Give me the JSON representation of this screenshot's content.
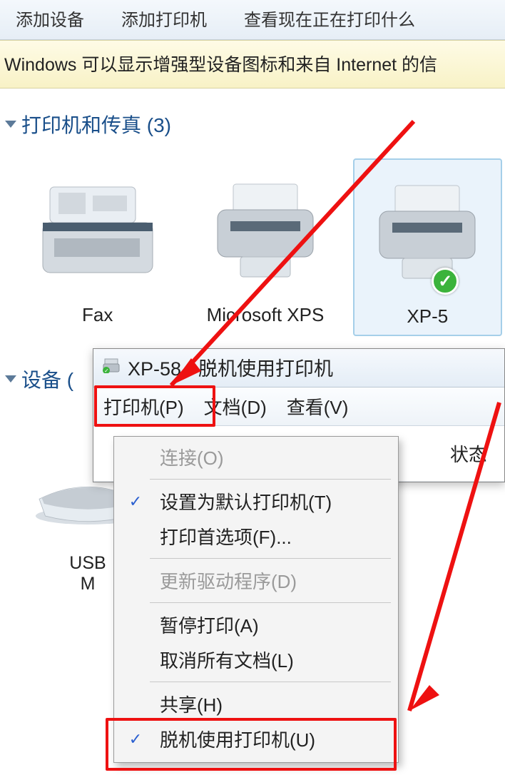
{
  "toolbar": {
    "add_device": "添加设备",
    "add_printer": "添加打印机",
    "view_print_queue": "查看现在正在打印什么"
  },
  "notice": "Windows 可以显示增强型设备图标和来自 Internet 的信",
  "section_printers": {
    "title": "打印机和传真 (3)"
  },
  "devices": [
    {
      "label": "Fax"
    },
    {
      "label": "Microsoft XPS"
    },
    {
      "label": "XP-5"
    }
  ],
  "section_devices": {
    "title": "设备 ("
  },
  "scanner": {
    "line1": "USB",
    "line2": "M"
  },
  "queue": {
    "title": "XP-58  -  脱机使用打印机",
    "menu": {
      "printer": "打印机(P)",
      "document": "文档(D)",
      "view": "查看(V)"
    },
    "columns": {
      "status": "状态"
    }
  },
  "dropdown": {
    "connect": "连接(O)",
    "set_default": "设置为默认打印机(T)",
    "preferences": "打印首选项(F)...",
    "update_driver": "更新驱动程序(D)",
    "pause": "暂停打印(A)",
    "cancel_all": "取消所有文档(L)",
    "share": "共享(H)",
    "use_offline": "脱机使用打印机(U)"
  }
}
